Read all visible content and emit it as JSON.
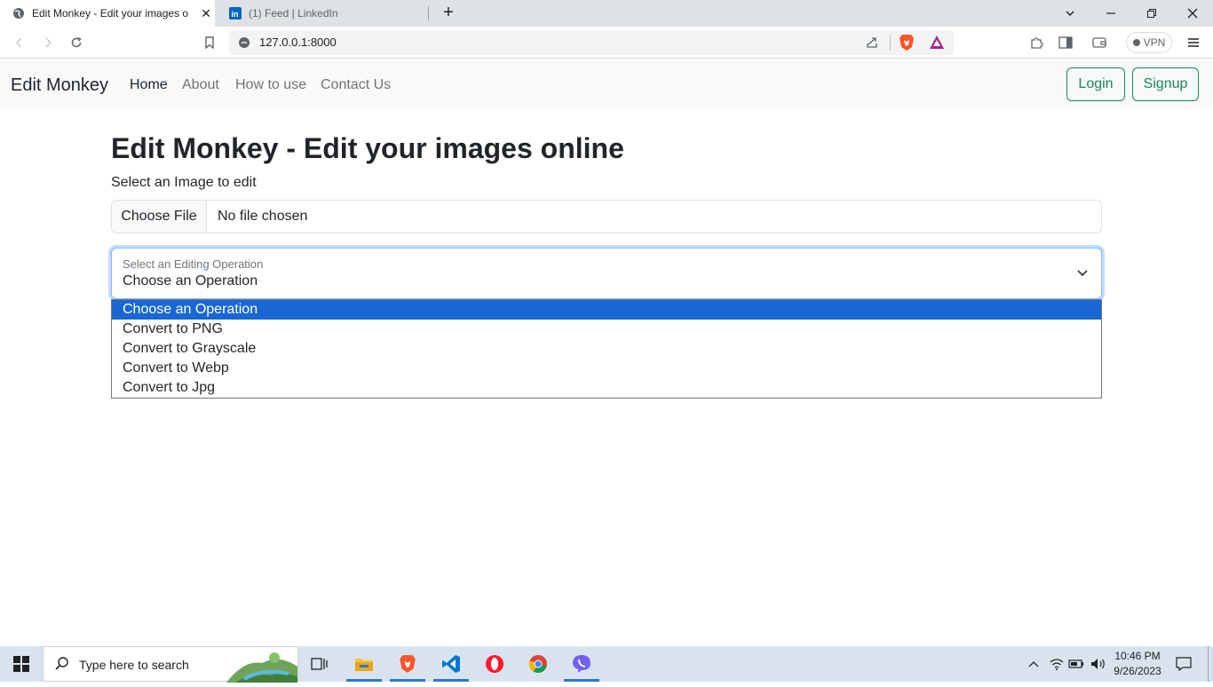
{
  "browser": {
    "tabs": [
      {
        "title": "Edit Monkey - Edit your images o",
        "active": true
      },
      {
        "title": "(1) Feed | LinkedIn",
        "active": false
      }
    ],
    "url": "127.0.0.1:8000",
    "vpn_label": "VPN"
  },
  "navbar": {
    "brand": "Edit Monkey",
    "links": [
      "Home",
      "About",
      "How to use",
      "Contact Us"
    ],
    "login": "Login",
    "signup": "Signup"
  },
  "main": {
    "heading": "Edit Monkey - Edit your images online",
    "select_label": "Select an Image to edit",
    "file_button": "Choose File",
    "file_status": "No file chosen",
    "operation_label": "Select an Editing Operation",
    "operation_value": "Choose an Operation",
    "options": [
      "Choose an Operation",
      "Convert to PNG",
      "Convert to Grayscale",
      "Convert to Webp",
      "Convert to Jpg"
    ]
  },
  "taskbar": {
    "search_placeholder": "Type here to search",
    "time": "10:46 PM",
    "date": "9/26/2023"
  },
  "colors": {
    "accent_green": "#198754",
    "selected_option": "#1967d2",
    "focus_border": "#86b7fe"
  }
}
